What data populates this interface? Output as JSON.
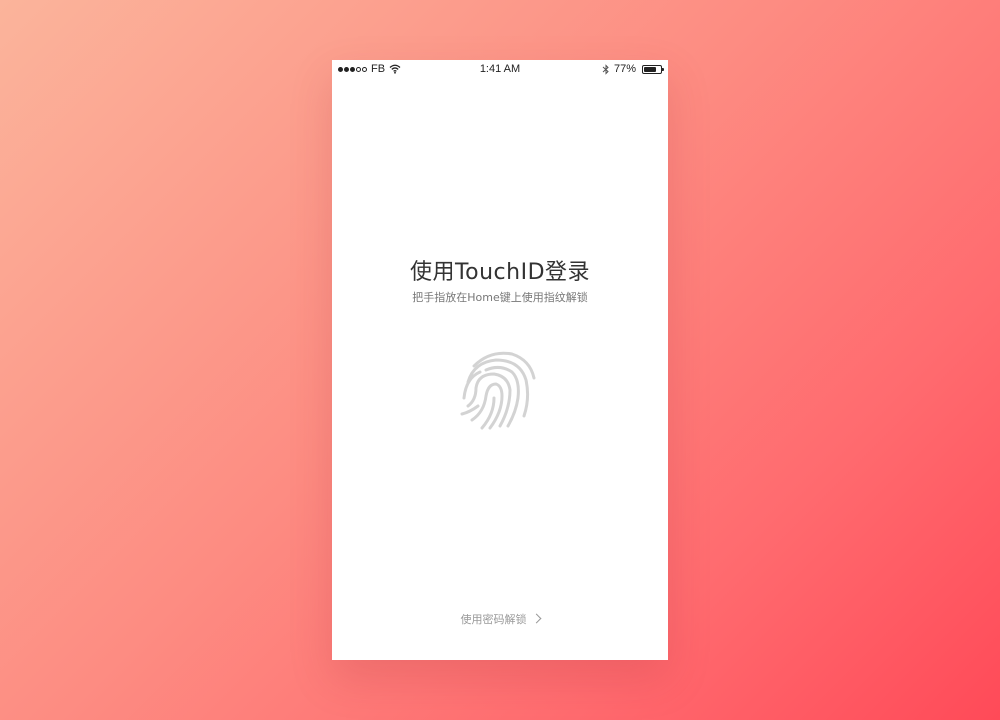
{
  "status_bar": {
    "carrier": "FB",
    "time": "1:41 AM",
    "battery_text": "77%",
    "battery_level": 0.77,
    "signal_strength": 3,
    "signal_max": 5
  },
  "login": {
    "title": "使用TouchID登录",
    "subtitle": "把手指放在Home键上使用指纹解锁",
    "fingerprint_icon": "fingerprint-icon",
    "password_link": "使用密码解锁"
  },
  "colors": {
    "background_start": "#fbb49b",
    "background_end": "#ff4a58",
    "fingerprint": "#d3d3d3"
  }
}
